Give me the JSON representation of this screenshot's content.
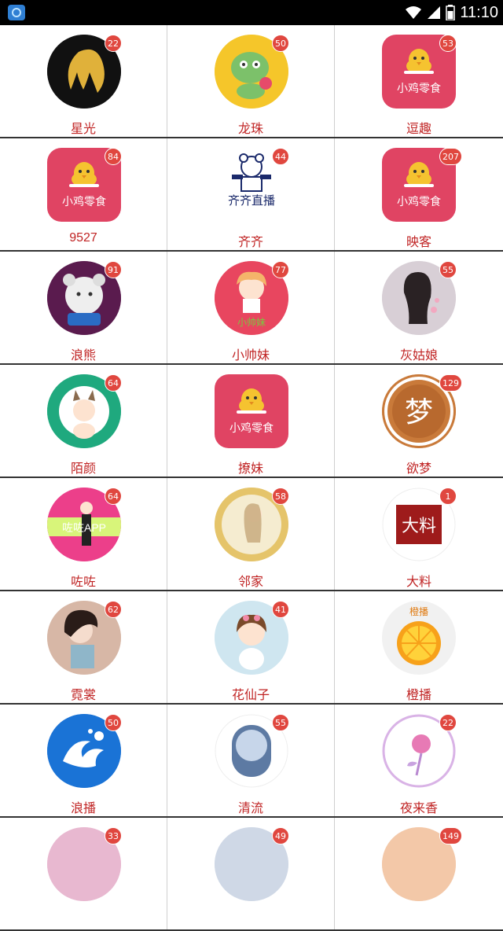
{
  "status": {
    "time": "11:10"
  },
  "rows": [
    [
      {
        "label": "星光",
        "badge": "22",
        "icon": "golden-hair-icon",
        "bg": "#111111",
        "shape": "circle"
      },
      {
        "label": "龙珠",
        "badge": "50",
        "icon": "green-dragon-icon",
        "bg": "#f5c62a",
        "shape": "circle"
      },
      {
        "label": "逗趣",
        "badge": "53",
        "icon": "chick-food-icon",
        "bg": "#e04463",
        "shape": "square"
      }
    ],
    [
      {
        "label": "9527",
        "badge": "84",
        "icon": "chick-food-icon",
        "bg": "#e04463",
        "shape": "square"
      },
      {
        "label": "齐齐",
        "badge": "44",
        "icon": "bear-live-icon",
        "bg": "#ffffff",
        "shape": "square"
      },
      {
        "label": "映客",
        "badge": "207",
        "icon": "chick-food-icon",
        "bg": "#e04463",
        "shape": "square"
      }
    ],
    [
      {
        "label": "浪熊",
        "badge": "91",
        "icon": "white-bear-icon",
        "bg": "#5a1b4e",
        "shape": "circle"
      },
      {
        "label": "小帅妹",
        "badge": "77",
        "icon": "anime-girl-icon",
        "bg": "#e8465f",
        "shape": "circle"
      },
      {
        "label": "灰姑娘",
        "badge": "55",
        "icon": "girl-portrait-icon",
        "bg": "#d8cfd6",
        "shape": "circle"
      }
    ],
    [
      {
        "label": "陌颜",
        "badge": "64",
        "icon": "cat-girl-icon",
        "bg": "#1fa97e",
        "shape": "circle"
      },
      {
        "label": "撩妹",
        "badge": "",
        "icon": "chick-food-icon",
        "bg": "#e04463",
        "shape": "square"
      },
      {
        "label": "欲梦",
        "badge": "129",
        "icon": "dream-icon",
        "bg": "#c97a3a",
        "shape": "circle"
      }
    ],
    [
      {
        "label": "咗咗",
        "badge": "64",
        "icon": "dancer-icon",
        "bg": "#ec3f8a",
        "shape": "circle"
      },
      {
        "label": "邻家",
        "badge": "58",
        "icon": "girl-gold-frame-icon",
        "bg": "#e5c46a",
        "shape": "circle"
      },
      {
        "label": "大料",
        "badge": "1",
        "icon": "daliao-icon",
        "bg": "#ffffff",
        "shape": "circle"
      }
    ],
    [
      {
        "label": "霓裳",
        "badge": "62",
        "icon": "lady-portrait-icon",
        "bg": "#d7b7a6",
        "shape": "circle"
      },
      {
        "label": "花仙子",
        "badge": "41",
        "icon": "flower-fairy-icon",
        "bg": "#cfe6f0",
        "shape": "circle"
      },
      {
        "label": "橙播",
        "badge": "",
        "icon": "orange-slice-icon",
        "bg": "#f1f1f1",
        "shape": "circle"
      }
    ],
    [
      {
        "label": "浪播",
        "badge": "50",
        "icon": "wave-icon",
        "bg": "#1a73d6",
        "shape": "circle"
      },
      {
        "label": "清流",
        "badge": "55",
        "icon": "moon-icon",
        "bg": "#ffffff",
        "shape": "circle"
      },
      {
        "label": "夜来香",
        "badge": "22",
        "icon": "rose-icon",
        "bg": "#ffffff",
        "shape": "circle"
      }
    ],
    [
      {
        "label": "",
        "badge": "33",
        "icon": "partial-icon",
        "bg": "#e8b8d0",
        "shape": "circle"
      },
      {
        "label": "",
        "badge": "49",
        "icon": "partial-icon",
        "bg": "#cfd8e6",
        "shape": "circle"
      },
      {
        "label": "",
        "badge": "149",
        "icon": "partial-icon",
        "bg": "#f3c8a8",
        "shape": "circle"
      }
    ]
  ],
  "icon_texts": {
    "chick_food": "小鸡零食",
    "bear_live": "齐齐直播",
    "dream": "梦",
    "daliao": "大料",
    "xsm": "小帅妹",
    "zz": "咗咗APP",
    "orange": "橙播"
  }
}
